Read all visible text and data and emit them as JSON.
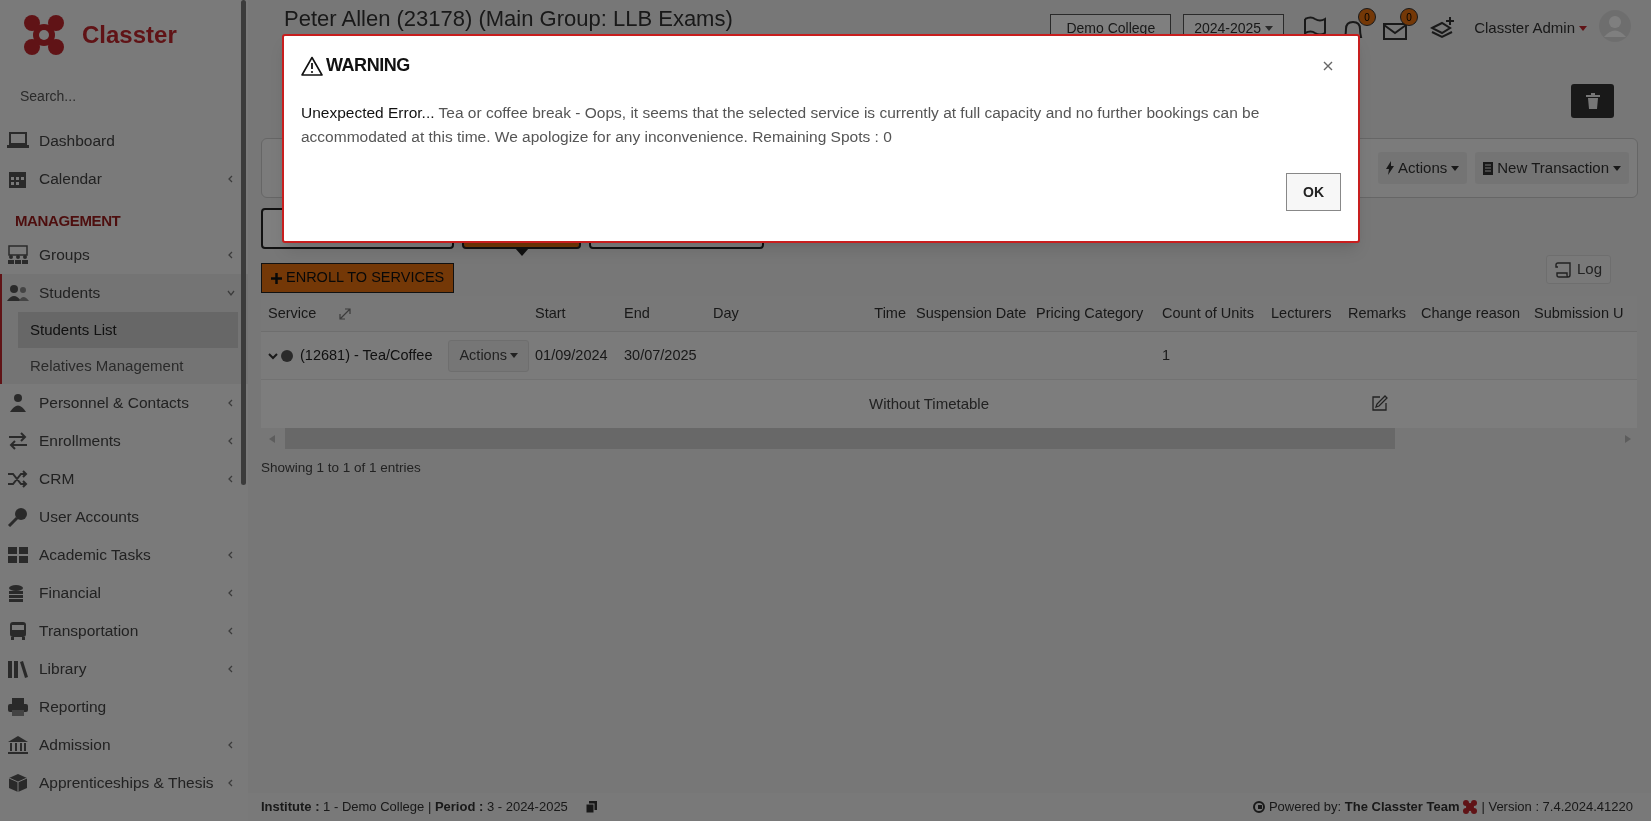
{
  "logo": {
    "text": "Classter"
  },
  "sidebar": {
    "search": {
      "placeholder": "Search..."
    },
    "items": [
      {
        "kind": "item",
        "label": "Dashboard",
        "selected": false
      },
      {
        "kind": "item",
        "label": "Calendar",
        "expanded": false,
        "selected": false
      },
      {
        "kind": "section",
        "label": "MANAGEMENT"
      },
      {
        "kind": "item",
        "label": "Groups",
        "expanded": false,
        "selected": false
      },
      {
        "kind": "item",
        "label": "Students",
        "expanded": true,
        "selected": true,
        "children": [
          {
            "label": "Students List",
            "selected": true
          },
          {
            "label": "Relatives Management",
            "selected": false
          }
        ]
      },
      {
        "kind": "item",
        "label": "Personnel & Contacts",
        "expanded": false,
        "selected": false
      },
      {
        "kind": "item",
        "label": "Enrollments",
        "expanded": false,
        "selected": false
      },
      {
        "kind": "item",
        "label": "CRM",
        "expanded": false,
        "selected": false
      },
      {
        "kind": "item",
        "label": "User Accounts",
        "selected": false
      },
      {
        "kind": "item",
        "label": "Academic Tasks",
        "expanded": false,
        "selected": false
      },
      {
        "kind": "item",
        "label": "Financial",
        "expanded": false,
        "selected": false
      },
      {
        "kind": "item",
        "label": "Transportation",
        "expanded": false,
        "selected": false
      },
      {
        "kind": "item",
        "label": "Library",
        "expanded": false,
        "selected": false
      },
      {
        "kind": "item",
        "label": "Reporting",
        "selected": false
      },
      {
        "kind": "item",
        "label": "Admission",
        "expanded": false,
        "selected": false
      },
      {
        "kind": "item",
        "label": "Apprenticeships & Thesis",
        "expanded": false,
        "selected": false
      }
    ]
  },
  "header": {
    "title": "Peter Allen (23178) (Main Group: LLB Exams)",
    "college": "Demo College",
    "period": "2024-2025",
    "notification_count": "0",
    "message_count": "0",
    "user": "Classter Admin"
  },
  "toolbar": {
    "buttons": [
      "Actions",
      "New Transaction"
    ]
  },
  "tabs": [
    {
      "selected": false
    },
    {
      "selected": true
    },
    {
      "selected": false
    }
  ],
  "enroll_button": "ENROLL TO SERVICES",
  "log_button": "Log",
  "table": {
    "columns": [
      "Service",
      "Start",
      "End",
      "Day",
      "Time",
      "Suspension Date",
      "Pricing Category",
      "Count of Units",
      "Lecturers",
      "Remarks",
      "Change reason",
      "Submission U"
    ],
    "rows": [
      {
        "service": "(12681) - Tea/Coffee",
        "expanded": true,
        "actions": "Actions",
        "start": "01/09/2024",
        "end": "30/07/2025",
        "count_of_units": "1",
        "detail": "Without Timetable"
      }
    ]
  },
  "pagination": "Showing 1 to 1 of 1 entries",
  "footer": {
    "left": "**Institute :** 1 - Demo College | **Period :** 3 - 2024-2025",
    "powered": "Powered by: **The Classter Team**",
    "version": "| Version : 7.4.2024.41220"
  },
  "modal": {
    "title": "WARNING",
    "error": "Unexpected Error...",
    "message": "Tea or coffee break - Oops, it seems that the selected service is currently at full capacity and no further bookings can be accommodated at this time. We apologize for any inconvenience. Remaining Spots : 0",
    "ok": "OK"
  }
}
